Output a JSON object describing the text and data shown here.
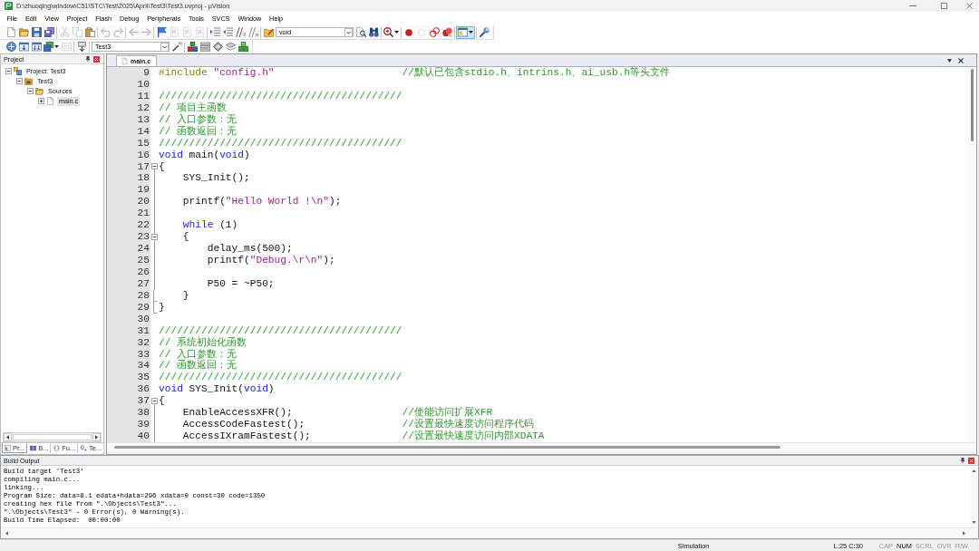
{
  "window": {
    "title": "D:\\zhuoqing\\window\\C51\\STC\\Test\\2025\\April\\Test3\\Test3.uvproj - µVision"
  },
  "menu": [
    "File",
    "Edit",
    "View",
    "Project",
    "Flash",
    "Debug",
    "Peripherals",
    "Tools",
    "SVCS",
    "Window",
    "Help"
  ],
  "toolbars": [
    {
      "items": [
        {
          "kind": "new",
          "disabled": false,
          "pressed": false,
          "menu": false
        },
        {
          "kind": "open",
          "disabled": false,
          "pressed": false,
          "menu": false
        },
        {
          "kind": "save",
          "disabled": false,
          "pressed": false,
          "menu": false
        },
        {
          "kind": "save_all",
          "disabled": false,
          "pressed": false,
          "menu": false
        },
        {
          "kind": "separator"
        },
        {
          "kind": "cut",
          "disabled": true,
          "pressed": false,
          "menu": false
        },
        {
          "kind": "copy",
          "disabled": true,
          "pressed": false,
          "menu": false
        },
        {
          "kind": "paste",
          "disabled": false,
          "pressed": false,
          "menu": false
        },
        {
          "kind": "separator"
        },
        {
          "kind": "undo",
          "disabled": true,
          "pressed": false,
          "menu": false
        },
        {
          "kind": "redo",
          "disabled": true,
          "pressed": false,
          "menu": false
        },
        {
          "kind": "separator"
        },
        {
          "kind": "back",
          "disabled": true,
          "pressed": false,
          "menu": false
        },
        {
          "kind": "forward",
          "disabled": true,
          "pressed": false,
          "menu": false
        },
        {
          "kind": "separator"
        },
        {
          "kind": "bookmark",
          "disabled": false,
          "pressed": false,
          "menu": false
        },
        {
          "kind": "bookmark_prev",
          "disabled": true,
          "pressed": false,
          "menu": false
        },
        {
          "kind": "bookmark_next",
          "disabled": true,
          "pressed": false,
          "menu": false
        },
        {
          "kind": "bookmark_clear",
          "disabled": true,
          "pressed": false,
          "menu": false
        },
        {
          "kind": "separator"
        },
        {
          "kind": "indent",
          "disabled": false,
          "pressed": false,
          "menu": false
        },
        {
          "kind": "unindent",
          "disabled": false,
          "pressed": false,
          "menu": false
        },
        {
          "kind": "comment",
          "disabled": false,
          "pressed": false,
          "menu": false
        },
        {
          "kind": "uncomment",
          "disabled": false,
          "pressed": false,
          "menu": false
        },
        {
          "kind": "separator"
        },
        {
          "kind": "find_files",
          "disabled": false,
          "pressed": false,
          "menu": false
        },
        {
          "kind": "combo",
          "value": "void"
        },
        {
          "kind": "find",
          "disabled": false,
          "pressed": false,
          "menu": false
        },
        {
          "kind": "incremental_find",
          "disabled": false,
          "pressed": false,
          "menu": false
        },
        {
          "kind": "separator"
        },
        {
          "kind": "debug",
          "disabled": false,
          "pressed": false,
          "menu": true
        },
        {
          "kind": "separator"
        },
        {
          "kind": "breakpoint",
          "disabled": false,
          "pressed": false,
          "menu": false
        },
        {
          "kind": "breakpoint_enable",
          "disabled": true,
          "pressed": false,
          "menu": false
        },
        {
          "kind": "breakpoint_disable",
          "disabled": false,
          "pressed": false,
          "menu": false
        },
        {
          "kind": "breakpoint_kill",
          "disabled": false,
          "pressed": false,
          "menu": false
        },
        {
          "kind": "separator"
        },
        {
          "kind": "window",
          "disabled": false,
          "pressed": true,
          "menu": true
        },
        {
          "kind": "separator"
        },
        {
          "kind": "config",
          "disabled": false,
          "pressed": false,
          "menu": false
        }
      ]
    },
    {
      "items": [
        {
          "kind": "translate",
          "disabled": false,
          "pressed": false,
          "menu": false
        },
        {
          "kind": "build",
          "disabled": false,
          "pressed": false,
          "menu": false
        },
        {
          "kind": "rebuild",
          "disabled": false,
          "pressed": false,
          "menu": false
        },
        {
          "kind": "batch",
          "disabled": false,
          "pressed": false,
          "menu": true
        },
        {
          "kind": "stop",
          "disabled": true,
          "pressed": false,
          "menu": false
        },
        {
          "kind": "separator"
        },
        {
          "kind": "download",
          "disabled": false,
          "pressed": false,
          "menu": false
        },
        {
          "kind": "separator"
        },
        {
          "kind": "combo",
          "value": "Test3"
        },
        {
          "kind": "options",
          "disabled": false,
          "pressed": false,
          "menu": false
        },
        {
          "kind": "separator"
        },
        {
          "kind": "manage",
          "disabled": false,
          "pressed": false,
          "menu": false
        },
        {
          "kind": "books",
          "disabled": false,
          "pressed": false,
          "menu": false
        },
        {
          "kind": "rte",
          "disabled": false,
          "pressed": false,
          "menu": false
        },
        {
          "kind": "layers",
          "disabled": false,
          "pressed": false,
          "menu": false
        },
        {
          "kind": "packs",
          "disabled": false,
          "pressed": false,
          "menu": false
        }
      ]
    }
  ],
  "project": {
    "title": "Project",
    "tree": [
      {
        "label": "Project: Test3",
        "kind": "project",
        "expanded": true,
        "selected": false,
        "children": [
          {
            "label": "Test3",
            "kind": "target",
            "expanded": true,
            "selected": false,
            "children": [
              {
                "label": "Sources",
                "kind": "group",
                "expanded": true,
                "selected": false,
                "children": [
                  {
                    "label": "main.c",
                    "kind": "file",
                    "expanded": false,
                    "selected": true
                  }
                ]
              }
            ]
          }
        ]
      }
    ],
    "tabs": [
      {
        "label": "Pr...",
        "kind": "project",
        "selected": true
      },
      {
        "label": "B...",
        "kind": "books",
        "selected": false
      },
      {
        "label": "Fu...",
        "kind": "functions",
        "selected": false
      },
      {
        "label": "Te...",
        "kind": "templates",
        "selected": false
      }
    ]
  },
  "editor": {
    "tabs": [
      {
        "label": "main.c",
        "selected": true
      }
    ],
    "lines": [
      {
        "number": "9",
        "tokens": [
          {
            "kind": "pre",
            "text": "#include "
          },
          {
            "kind": "str",
            "text": "\"config.h\"                     "
          },
          {
            "kind": "cmt",
            "text": "//默认已包含stdio.h、intrins.h、ai_usb.h等头文件"
          }
        ]
      },
      {
        "number": "10"
      },
      {
        "number": "11",
        "tokens": [
          {
            "kind": "cmt",
            "text": "////////////////////////////////////////"
          }
        ]
      },
      {
        "number": "12",
        "tokens": [
          {
            "kind": "cmt",
            "text": "// 项目主函数"
          }
        ]
      },
      {
        "number": "13",
        "tokens": [
          {
            "kind": "cmt",
            "text": "// 入口参数：无"
          }
        ]
      },
      {
        "number": "14",
        "tokens": [
          {
            "kind": "cmt",
            "text": "// 函数返回：无"
          }
        ]
      },
      {
        "number": "15",
        "tokens": [
          {
            "kind": "cmt",
            "text": "////////////////////////////////////////"
          }
        ]
      },
      {
        "number": "16",
        "tokens": [
          {
            "kind": "kw",
            "text": "void"
          },
          {
            "kind": "txt",
            "text": " main("
          },
          {
            "kind": "kw",
            "text": "void"
          },
          {
            "kind": "txt",
            "text": ")"
          }
        ]
      },
      {
        "number": "17",
        "fold": {
          "expanded": true
        },
        "tokens": [
          {
            "kind": "txt",
            "text": "{"
          }
        ]
      },
      {
        "number": "18",
        "tokens": [
          {
            "kind": "txt",
            "text": "    SYS_Init();"
          }
        ]
      },
      {
        "number": "19"
      },
      {
        "number": "20",
        "tokens": [
          {
            "kind": "txt",
            "text": "    printf("
          },
          {
            "kind": "str",
            "text": "\"Hello World !\\n\""
          },
          {
            "kind": "txt",
            "text": ");"
          }
        ]
      },
      {
        "number": "21"
      },
      {
        "number": "22",
        "tokens": [
          {
            "kind": "kw",
            "text": "    while"
          },
          {
            "kind": "txt",
            "text": " (1)"
          }
        ]
      },
      {
        "number": "23",
        "fold": {
          "expanded": true
        },
        "tokens": [
          {
            "kind": "txt",
            "text": "    {"
          }
        ]
      },
      {
        "number": "24",
        "tokens": [
          {
            "kind": "txt",
            "text": "        delay_ms(500);"
          }
        ]
      },
      {
        "number": "25",
        "tokens": [
          {
            "kind": "txt",
            "text": "        printf("
          },
          {
            "kind": "str",
            "text": "\"Debug.\\r\\n\""
          },
          {
            "kind": "txt",
            "text": ");"
          }
        ]
      },
      {
        "number": "26"
      },
      {
        "number": "27",
        "tokens": [
          {
            "kind": "txt",
            "text": "        P50 = ~P50;"
          }
        ]
      },
      {
        "number": "28",
        "fold_end": true,
        "tokens": [
          {
            "kind": "txt",
            "text": "    }"
          }
        ]
      },
      {
        "number": "29",
        "fold_end": true,
        "tokens": [
          {
            "kind": "txt",
            "text": "}"
          }
        ]
      },
      {
        "number": "30"
      },
      {
        "number": "31",
        "tokens": [
          {
            "kind": "cmt",
            "text": "////////////////////////////////////////"
          }
        ]
      },
      {
        "number": "32",
        "tokens": [
          {
            "kind": "cmt",
            "text": "// 系统初始化函数"
          }
        ]
      },
      {
        "number": "33",
        "tokens": [
          {
            "kind": "cmt",
            "text": "// 入口参数：无"
          }
        ]
      },
      {
        "number": "34",
        "tokens": [
          {
            "kind": "cmt",
            "text": "// 函数返回：无"
          }
        ]
      },
      {
        "number": "35",
        "tokens": [
          {
            "kind": "cmt",
            "text": "////////////////////////////////////////"
          }
        ]
      },
      {
        "number": "36",
        "tokens": [
          {
            "kind": "kw",
            "text": "void"
          },
          {
            "kind": "txt",
            "text": " SYS_Init("
          },
          {
            "kind": "kw",
            "text": "void"
          },
          {
            "kind": "txt",
            "text": ")"
          }
        ]
      },
      {
        "number": "37",
        "fold": {
          "expanded": true
        },
        "tokens": [
          {
            "kind": "txt",
            "text": "{"
          }
        ]
      },
      {
        "number": "38",
        "tokens": [
          {
            "kind": "txt",
            "text": "    EnableAccessXFR();                  "
          },
          {
            "kind": "cmt",
            "text": "//使能访问扩展XFR"
          }
        ]
      },
      {
        "number": "39",
        "tokens": [
          {
            "kind": "txt",
            "text": "    AccessCodeFastest();                "
          },
          {
            "kind": "cmt",
            "text": "//设置最快速度访问程序代码"
          }
        ]
      },
      {
        "number": "40",
        "tokens": [
          {
            "kind": "txt",
            "text": "    AccessIXramFastest();               "
          },
          {
            "kind": "cmt",
            "text": "//设置最快速度访问内部XDATA"
          }
        ]
      }
    ]
  },
  "build_output": {
    "title": "Build Output",
    "lines": [
      "Build target 'Test3'",
      "compiling main.c...",
      "linking...",
      "Program Size: data=8.1 edata+hdata=296 xdata=0 const=30 code=1350",
      "creating hex file from \".\\Objects\\Test3\"...",
      "\".\\Objects\\Test3\" - 0 Error(s), 0 Warning(s).",
      "Build Time Elapsed:  00:00:00"
    ]
  },
  "status_bar": {
    "mode": "Simulation",
    "position": "L:25 C:30",
    "indicators": [
      {
        "label": "CAP",
        "on": false
      },
      {
        "label": "NUM",
        "on": true
      },
      {
        "label": "SCRL",
        "on": false
      },
      {
        "label": "OVR",
        "on": false
      },
      {
        "label": "R/W",
        "on": false
      }
    ]
  }
}
